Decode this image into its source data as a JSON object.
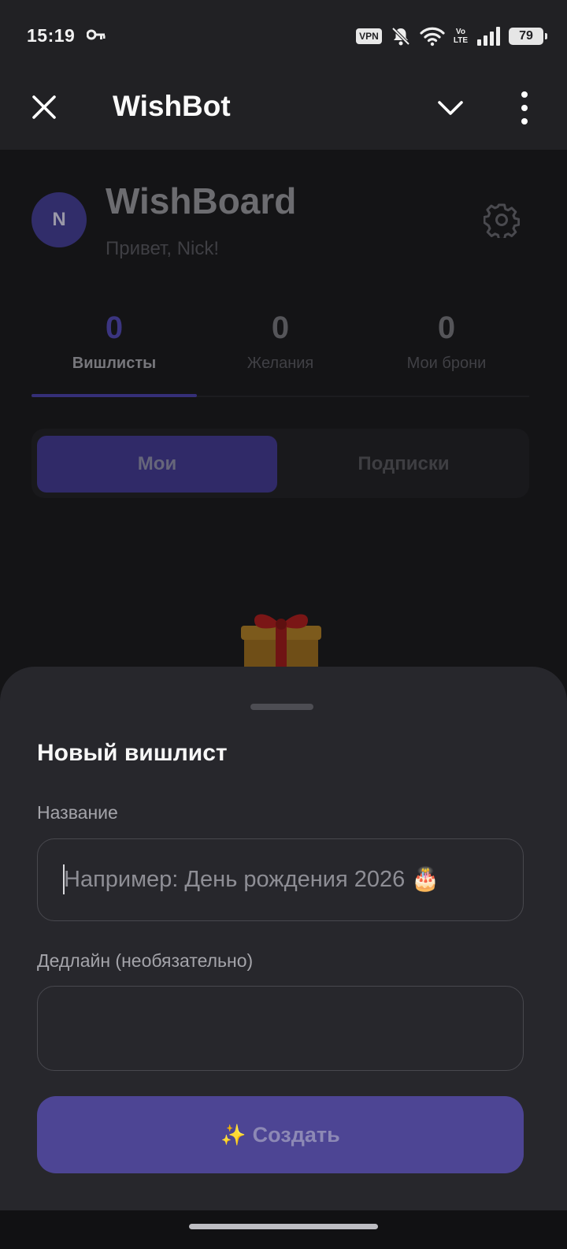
{
  "status_bar": {
    "time": "15:19",
    "vpn_label": "VPN",
    "volte_top": "Vo",
    "volte_bottom": "LTE",
    "battery": "79",
    "icons": [
      "key-icon",
      "vpn-icon",
      "bell-off-icon",
      "wifi-icon",
      "volte-icon",
      "signal-icon",
      "battery-icon"
    ]
  },
  "top_bar": {
    "title": "WishBot",
    "icons": [
      "close-icon",
      "chevron-down-icon",
      "more-vertical-icon"
    ]
  },
  "header": {
    "avatar_letter": "N",
    "app_title": "WishBoard",
    "greeting": "Привет, Nick!",
    "settings_icon": "gear-icon"
  },
  "stats": [
    {
      "value": "0",
      "label": "Вишлисты"
    },
    {
      "value": "0",
      "label": "Желания"
    },
    {
      "value": "0",
      "label": "Мои брони"
    }
  ],
  "segment": {
    "mine": "Мои",
    "subscriptions": "Подписки",
    "selected": "mine"
  },
  "empty_state": {
    "icon": "gift-icon"
  },
  "sheet": {
    "title": "Новый вишлист",
    "name_label": "Название",
    "name_placeholder": "Например: День рождения 2026 🎂",
    "name_value": "",
    "deadline_label": "Дедлайн (необязательно)",
    "deadline_value": "",
    "create_icon": "✨",
    "create_label": "Создать"
  },
  "colors": {
    "accent": "#4d4594",
    "sheet_bg": "#27272c",
    "app_bg": "#141416"
  }
}
